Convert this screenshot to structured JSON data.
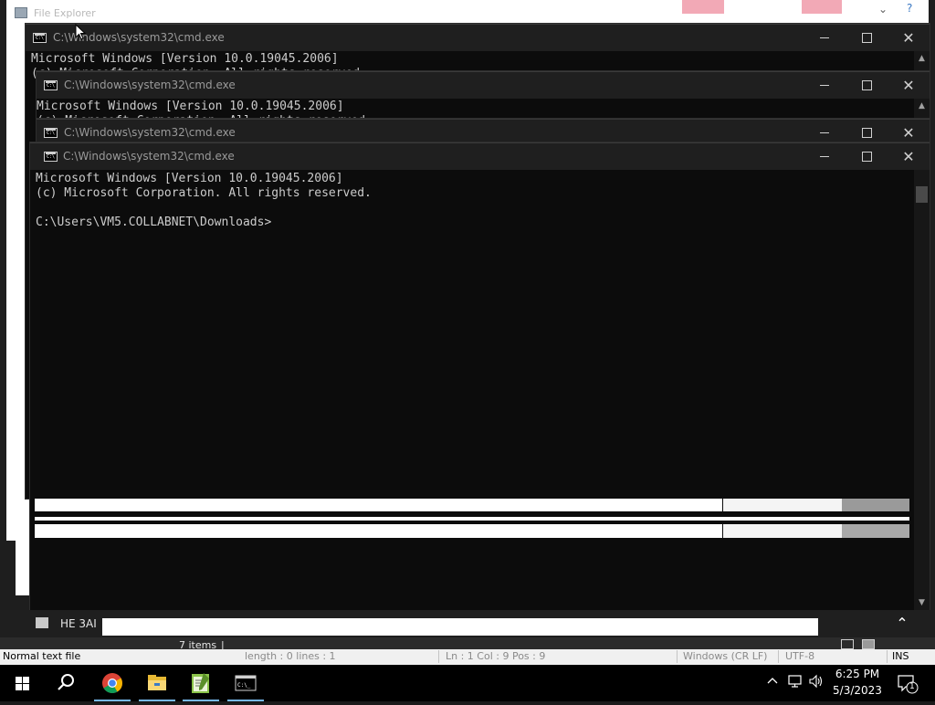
{
  "file_explorer": {
    "title": "File Explorer",
    "status_items": "7 items",
    "status_sep": "|",
    "row_text": "HE 3AI",
    "up_glyph": "⌃",
    "chevron": "⌄",
    "help": "?"
  },
  "notepadpp_status": {
    "mode": "Normal text file",
    "length": "length : 0    lines : 1",
    "position": "Ln : 1    Col : 9    Pos : 9",
    "eol": "Windows (CR LF)",
    "encoding": "UTF-8",
    "ins": "INS"
  },
  "cmd_windows": [
    {
      "title": "C:\\Windows\\system32\\cmd.exe",
      "line1": "Microsoft Windows [Version 10.0.19045.2006]",
      "line2": "(c) Microsoft Corporation. All rights reserved."
    },
    {
      "title": "C:\\Windows\\system32\\cmd.exe",
      "line1": "Microsoft Windows [Version 10.0.19045.2006]",
      "line2": "(c) Microsoft Corporation. All rights reserved."
    },
    {
      "title": "C:\\Windows\\system32\\cmd.exe"
    },
    {
      "title": "C:\\Windows\\system32\\cmd.exe",
      "line1": "Microsoft Windows [Version 10.0.19045.2006]",
      "line2": "(c) Microsoft Corporation. All rights reserved.",
      "line3": "",
      "line4": "C:\\Users\\VM5.COLLABNET\\Downloads>"
    }
  ],
  "window_buttons": {
    "close": "✕",
    "scroll_up": "▲",
    "scroll_down": "▼"
  },
  "taskbar": {
    "time": "6:25 PM",
    "date": "5/3/2023",
    "notification_count": "1",
    "pinned": [
      "start-icon",
      "search-icon",
      "chrome-icon",
      "file-explorer-icon",
      "notepadpp-icon",
      "cmd-icon"
    ],
    "tray": [
      "chevron-up-icon",
      "network-icon",
      "volume-icon",
      "notification-icon"
    ]
  }
}
